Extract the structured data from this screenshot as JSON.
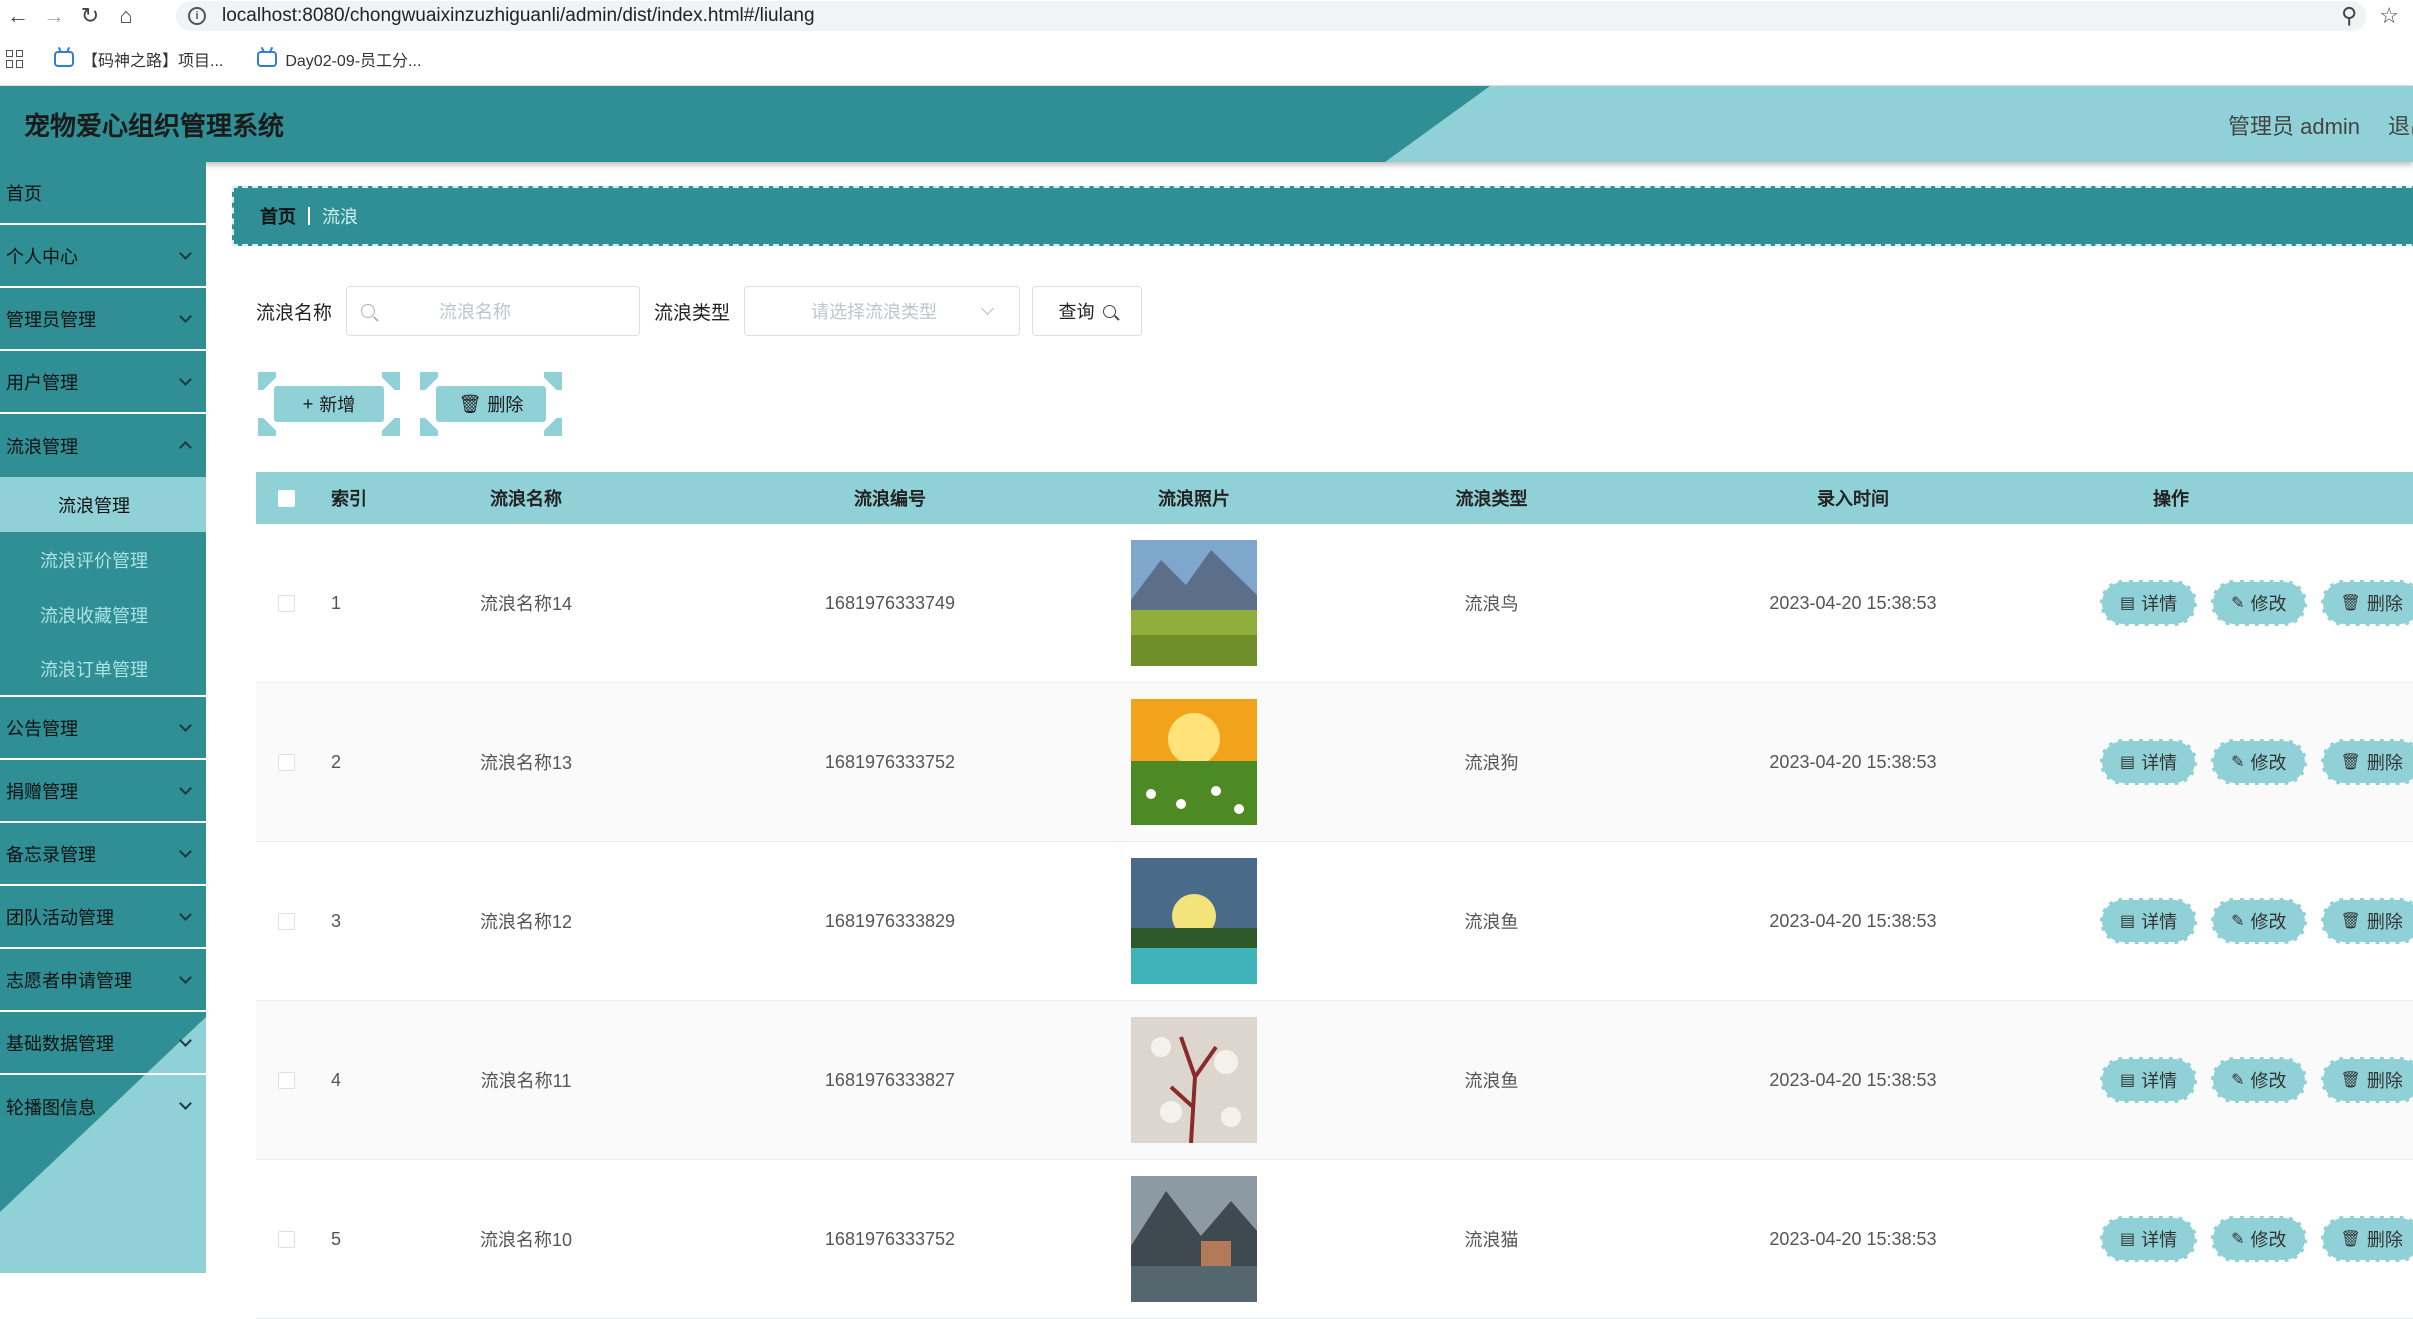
{
  "browser": {
    "url": "localhost:8080/chongwuaixinzuzhiguanli/admin/dist/index.html#/liulang",
    "bookmarks": [
      "【码神之路】项目...",
      "Day02-09-员工分..."
    ]
  },
  "header": {
    "title": "宠物爱心组织管理系统",
    "user_label": "管理员 admin",
    "logout_label": "退出"
  },
  "sidebar": {
    "items": [
      {
        "label": "首页",
        "has_children": false
      },
      {
        "label": "个人中心",
        "has_children": true
      },
      {
        "label": "管理员管理",
        "has_children": true
      },
      {
        "label": "用户管理",
        "has_children": true
      },
      {
        "label": "流浪管理",
        "has_children": true,
        "expanded": true,
        "children": [
          "流浪管理",
          "流浪评价管理",
          "流浪收藏管理",
          "流浪订单管理"
        ]
      },
      {
        "label": "公告管理",
        "has_children": true
      },
      {
        "label": "捐赠管理",
        "has_children": true
      },
      {
        "label": "备忘录管理",
        "has_children": true
      },
      {
        "label": "团队活动管理",
        "has_children": true
      },
      {
        "label": "志愿者申请管理",
        "has_children": true
      },
      {
        "label": "基础数据管理",
        "has_children": true
      },
      {
        "label": "轮播图信息",
        "has_children": true
      }
    ],
    "active_child": "流浪管理"
  },
  "breadcrumb": {
    "home": "首页",
    "current": "流浪"
  },
  "search": {
    "name_label": "流浪名称",
    "name_placeholder": "流浪名称",
    "type_label": "流浪类型",
    "type_placeholder": "请选择流浪类型",
    "query_label": "查询"
  },
  "actions": {
    "add_label": "新增",
    "delete_label": "删除"
  },
  "table": {
    "columns": [
      "索引",
      "流浪名称",
      "流浪编号",
      "流浪照片",
      "流浪类型",
      "录入时间",
      "操作"
    ],
    "op_labels": {
      "detail": "详情",
      "edit": "修改",
      "delete": "删除"
    },
    "rows": [
      {
        "index": "1",
        "name": "流浪名称14",
        "code": "1681976333749",
        "type": "流浪鸟",
        "time": "2023-04-20 15:38:53"
      },
      {
        "index": "2",
        "name": "流浪名称13",
        "code": "1681976333752",
        "type": "流浪狗",
        "time": "2023-04-20 15:38:53"
      },
      {
        "index": "3",
        "name": "流浪名称12",
        "code": "1681976333829",
        "type": "流浪鱼",
        "time": "2023-04-20 15:38:53"
      },
      {
        "index": "4",
        "name": "流浪名称11",
        "code": "1681976333827",
        "type": "流浪鱼",
        "time": "2023-04-20 15:38:53"
      },
      {
        "index": "5",
        "name": "流浪名称10",
        "code": "1681976333752",
        "type": "流浪猫",
        "time": "2023-04-20 15:38:53"
      }
    ]
  },
  "colors": {
    "primary": "#2f8f94",
    "accent": "#8fd1d6"
  }
}
